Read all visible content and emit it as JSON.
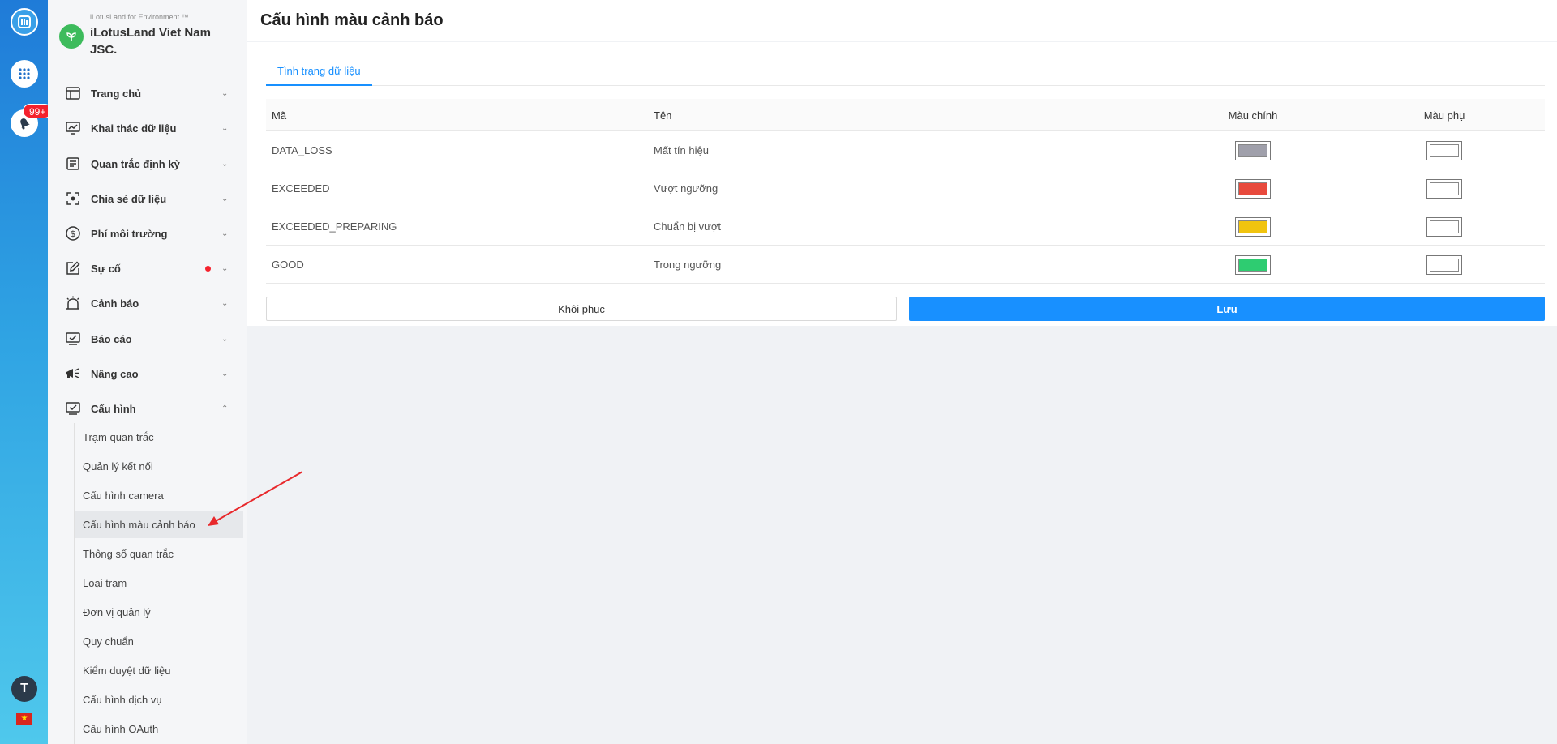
{
  "rail": {
    "notification_badge": "99+",
    "avatar_initial": "T",
    "language_flag": "vi-flag"
  },
  "org": {
    "subtitle": "iLotusLand for Environment ™",
    "name": "iLotusLand Viet Nam JSC."
  },
  "sidebar": {
    "items": [
      {
        "label": "Trang chủ",
        "icon": "layout-icon"
      },
      {
        "label": "Khai thác dữ liệu",
        "icon": "monitor-chart-icon"
      },
      {
        "label": "Quan trắc định kỳ",
        "icon": "document-list-icon"
      },
      {
        "label": "Chia sẻ dữ liệu",
        "icon": "share-focus-icon"
      },
      {
        "label": "Phí môi trường",
        "icon": "dollar-circle-icon"
      },
      {
        "label": "Sự cố",
        "icon": "edit-note-icon",
        "has_alert_dot": true
      },
      {
        "label": "Cảnh báo",
        "icon": "alarm-icon"
      },
      {
        "label": "Báo cáo",
        "icon": "report-icon"
      },
      {
        "label": "Nâng cao",
        "icon": "megaphone-icon"
      },
      {
        "label": "Cấu hình",
        "icon": "config-icon",
        "expanded": true
      }
    ],
    "submenu": [
      {
        "label": "Trạm quan trắc"
      },
      {
        "label": "Quản lý kết nối"
      },
      {
        "label": "Cấu hình camera"
      },
      {
        "label": "Cấu hình màu cảnh báo",
        "active": true
      },
      {
        "label": "Thông số quan trắc"
      },
      {
        "label": "Loại trạm"
      },
      {
        "label": "Đơn vị quản lý"
      },
      {
        "label": "Quy chuẩn"
      },
      {
        "label": "Kiểm duyệt dữ liệu"
      },
      {
        "label": "Cấu hình dịch vụ"
      },
      {
        "label": "Cấu hình OAuth"
      }
    ]
  },
  "page": {
    "title": "Cấu hình màu cảnh báo",
    "tab_label": "Tình trạng dữ liệu"
  },
  "table": {
    "headers": {
      "code": "Mã",
      "name": "Tên",
      "primary_color": "Màu chính",
      "secondary_color": "Màu phụ"
    },
    "rows": [
      {
        "code": "DATA_LOSS",
        "name": "Mất tín hiệu",
        "primary": "#a0a0ab",
        "secondary": "#ffffff"
      },
      {
        "code": "EXCEEDED",
        "name": "Vượt ngưỡng",
        "primary": "#e84a3d",
        "secondary": "#ffffff"
      },
      {
        "code": "EXCEEDED_PREPARING",
        "name": "Chuẩn bị vượt",
        "primary": "#f1c40f",
        "secondary": "#ffffff"
      },
      {
        "code": "GOOD",
        "name": "Trong ngưỡng",
        "primary": "#2ecc71",
        "secondary": "#ffffff"
      }
    ]
  },
  "actions": {
    "restore_label": "Khôi phục",
    "save_label": "Lưu"
  },
  "colors": {
    "accent": "#1890ff",
    "annotation_arrow": "#e8282b"
  }
}
